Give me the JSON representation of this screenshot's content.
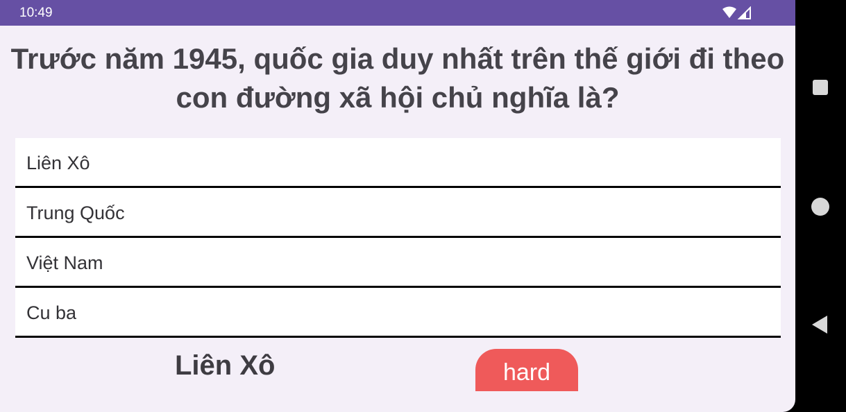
{
  "status_bar": {
    "time": "10:49",
    "icons": [
      "wifi-icon",
      "cell-signal-icon"
    ],
    "background_color": "#6650a4"
  },
  "quiz": {
    "question": "Trước năm 1945, quốc gia duy nhất trên thế giới đi theo con đường xã hội chủ nghĩa là?",
    "options": [
      {
        "label": "Liên Xô"
      },
      {
        "label": "Trung Quốc"
      },
      {
        "label": "Việt Nam"
      },
      {
        "label": "Cu ba"
      }
    ],
    "selected_answer": "Liên Xô",
    "difficulty": "hard",
    "difficulty_color": "#ef5a5a"
  },
  "nav_bar": {
    "buttons": [
      "recents-square-icon",
      "home-circle-icon",
      "back-triangle-icon"
    ]
  }
}
